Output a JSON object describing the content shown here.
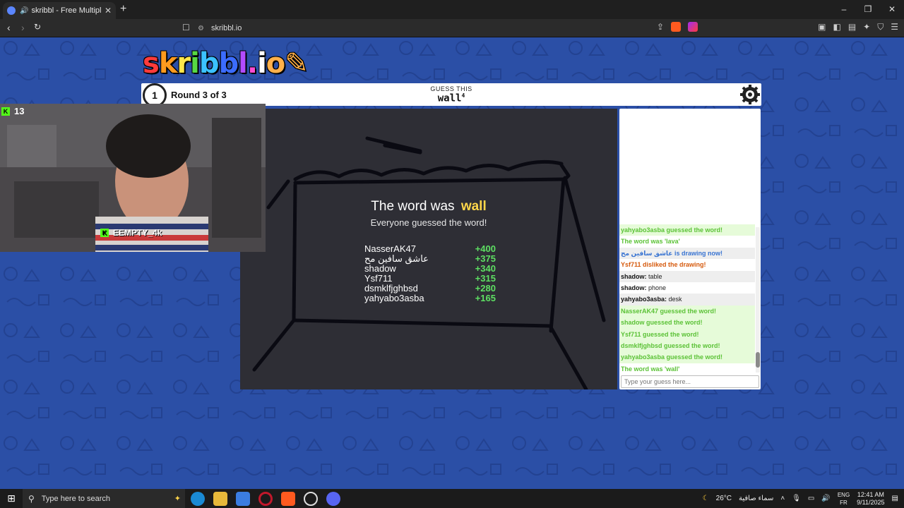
{
  "browser": {
    "tab_title": "skribbl - Free Multiplayer Dra",
    "new_tab": "+",
    "url": "skribbl.io",
    "window_controls": [
      "–",
      "❐",
      "✕"
    ]
  },
  "game": {
    "logo": "skribbl.io",
    "logo_colors": [
      "#ff3b3b",
      "#ff9b1e",
      "#ffe64a",
      "#57d944",
      "#3bc1ff",
      "#3b6cff",
      "#b34cff",
      "#ff4cd2",
      "#fff",
      "#ffb04a"
    ],
    "timer": "1",
    "round_text": "Round 3 of 3",
    "guess_label": "GUESS THIS",
    "guess_word": "wall",
    "guess_word_count": "4",
    "reveal_prefix": "The word was",
    "reveal_word": "wall",
    "reveal_sub": "Everyone guessed the word!",
    "scores": [
      {
        "name": "NasserAK47",
        "points": "+400"
      },
      {
        "name": "عاشق سافين مح",
        "points": "+375"
      },
      {
        "name": "shadow",
        "points": "+340"
      },
      {
        "name": "Ysf711",
        "points": "+315"
      },
      {
        "name": "dsmklfjghbsd",
        "points": "+280"
      },
      {
        "name": "yahyabo3asba",
        "points": "+165"
      }
    ]
  },
  "stream": {
    "viewer_count": "13",
    "channel_tag": "EEMPTY_4k"
  },
  "chat": {
    "messages": [
      {
        "style": "green",
        "text": "yahyabo3asba guessed the word!"
      },
      {
        "style": "green2",
        "text": "The word was 'lava'"
      },
      {
        "style": "blue",
        "text": "عاشق سافين مح is drawing now!"
      },
      {
        "style": "orange",
        "text": "Ysf711 disliked the drawing!"
      },
      {
        "style": "grey",
        "author": "shadow:",
        "text": "table"
      },
      {
        "style": "white",
        "author": "shadow:",
        "text": "phone"
      },
      {
        "style": "grey",
        "author": "yahyabo3asba:",
        "text": "desk"
      },
      {
        "style": "green",
        "text": "NasserAK47 guessed the word!"
      },
      {
        "style": "green",
        "text": "shadow guessed the word!"
      },
      {
        "style": "green",
        "text": "Ysf711 guessed the word!"
      },
      {
        "style": "green",
        "text": "dsmklfjghbsd guessed the word!"
      },
      {
        "style": "green",
        "text": "yahyabo3asba guessed the word!"
      },
      {
        "style": "green2",
        "text": "The word was 'wall'"
      }
    ],
    "input_placeholder": "Type your guess here..."
  },
  "taskbar": {
    "search_placeholder": "Type here to search",
    "weather": "26°C",
    "weather_desc": "سماء صافية",
    "lang_top": "ENG",
    "lang_bottom": "FR",
    "time": "12:41 AM",
    "date": "9/11/2025"
  }
}
